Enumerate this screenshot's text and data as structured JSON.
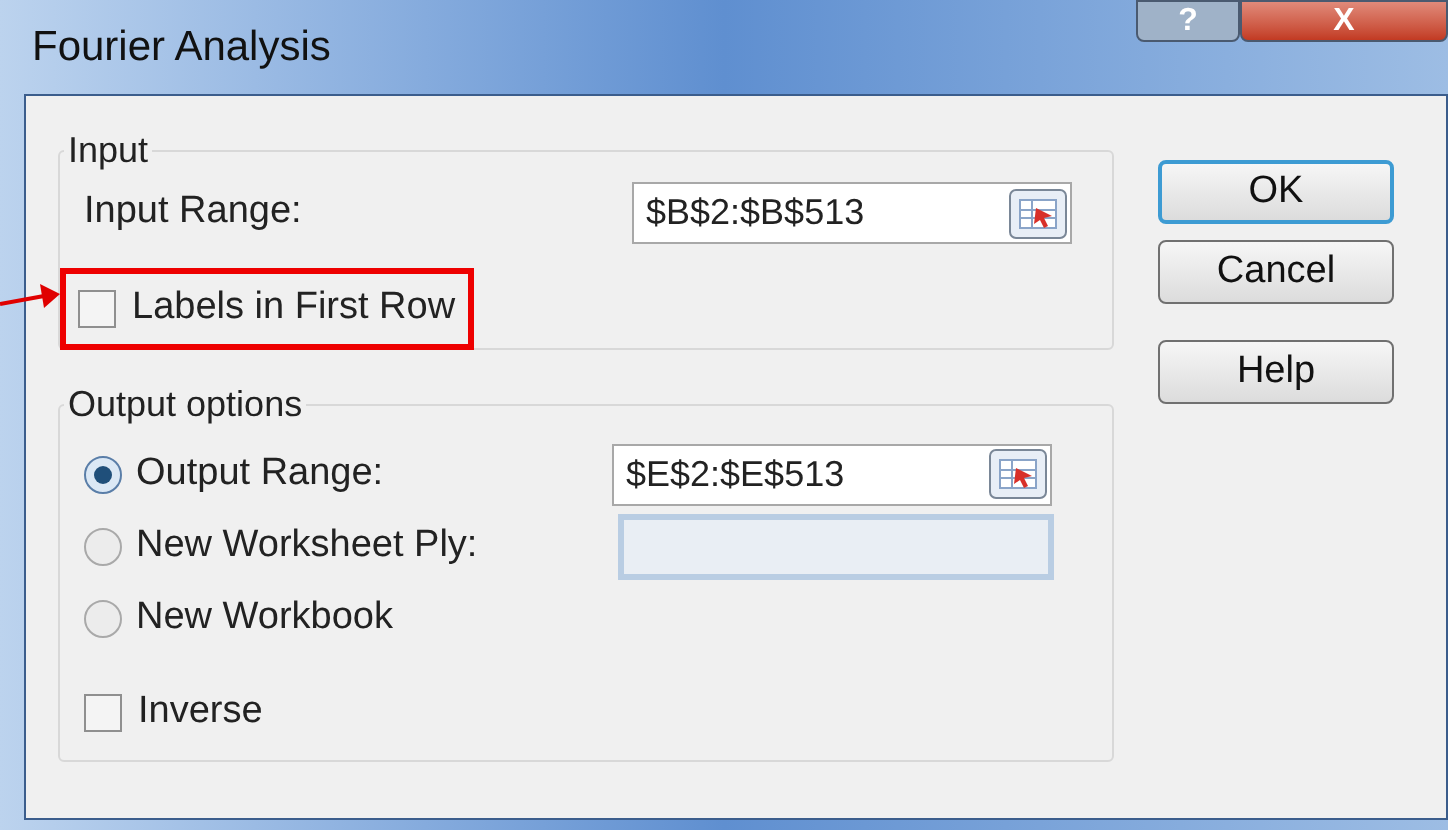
{
  "window": {
    "title": "Fourier Analysis",
    "caption_buttons": [
      "?",
      "X"
    ]
  },
  "input_group": {
    "title": "Input",
    "range_label": "Input Range:",
    "range_value": "$B$2:$B$513",
    "labels_checkbox": {
      "label": "Labels in First Row",
      "checked": false,
      "highlighted": true
    }
  },
  "output_group": {
    "title": "Output options",
    "options": [
      {
        "label": "Output Range:",
        "selected": true,
        "field_value": "$E$2:$E$513",
        "field_disabled": false
      },
      {
        "label": "New Worksheet Ply:",
        "selected": false,
        "field_disabled": true
      },
      {
        "label": "New Workbook",
        "selected": false
      }
    ],
    "inverse_checkbox": {
      "label": "Inverse",
      "checked": false
    }
  },
  "buttons": [
    {
      "label": "OK",
      "default": true
    },
    {
      "label": "Cancel",
      "default": false
    },
    {
      "label": "Help",
      "default": false
    }
  ]
}
